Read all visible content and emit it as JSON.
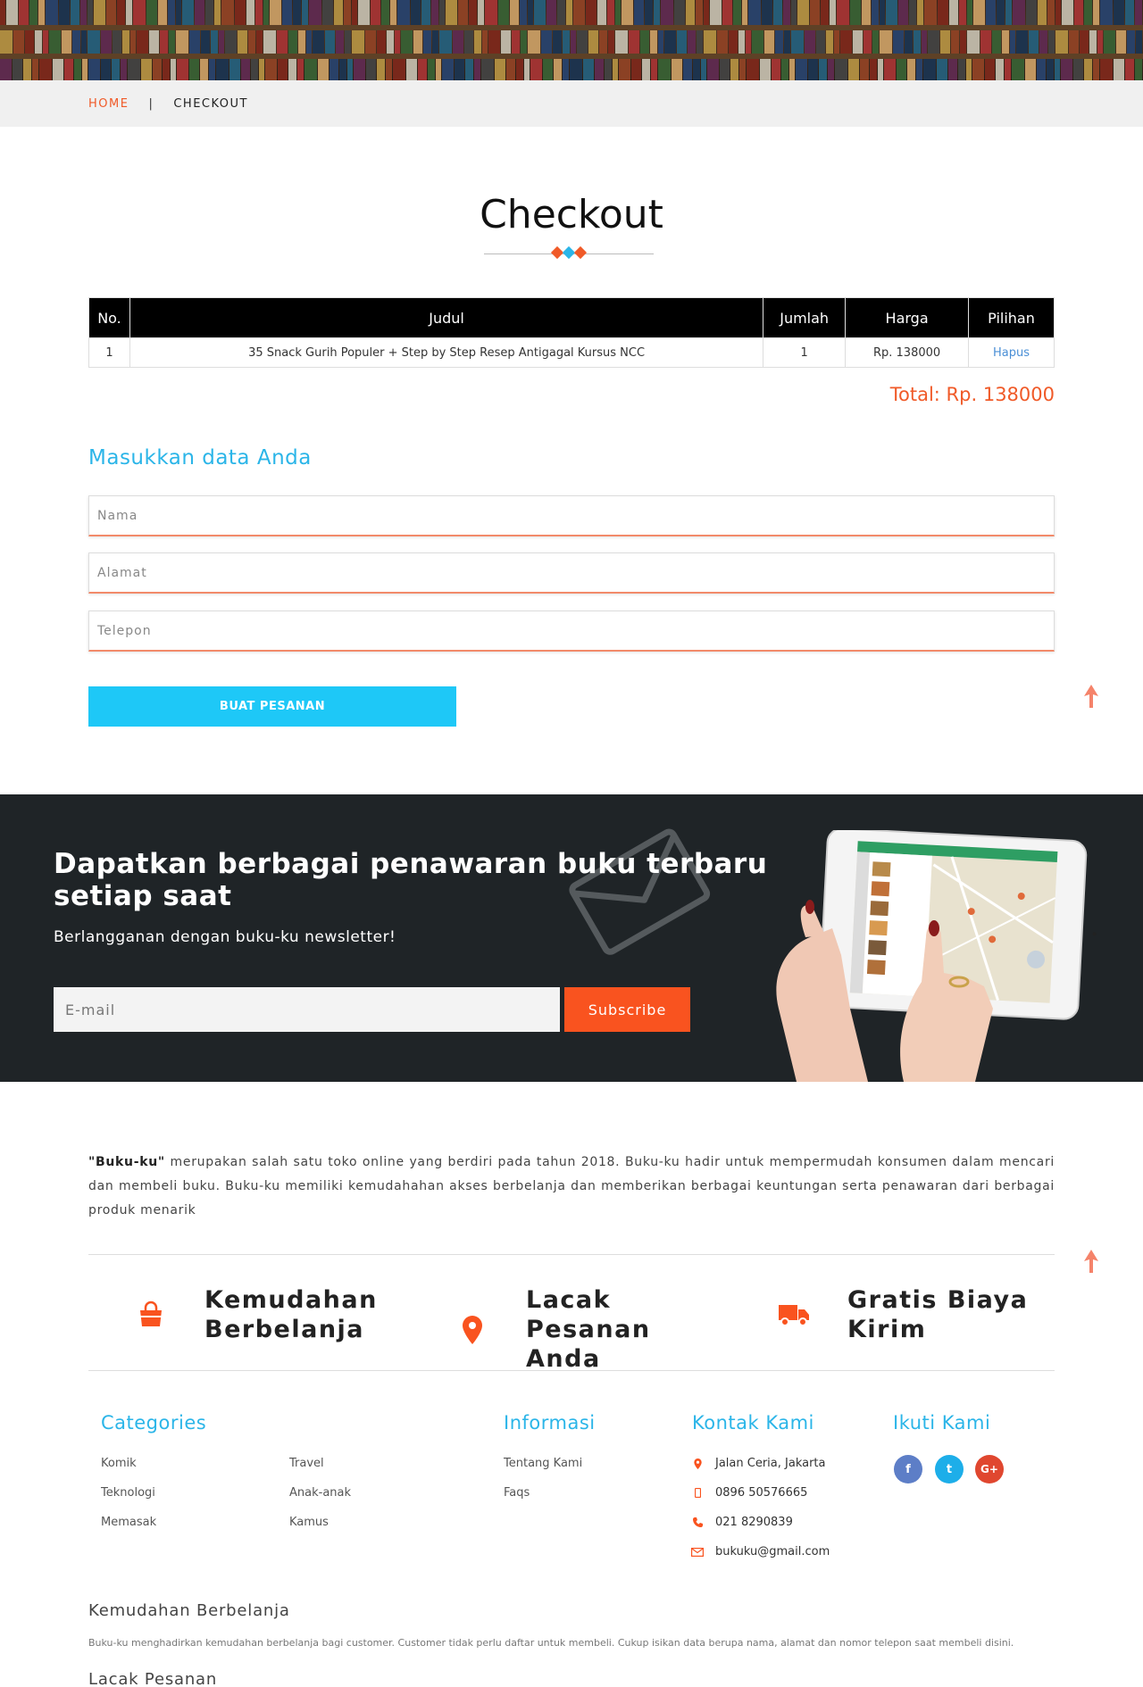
{
  "breadcrumb": {
    "home": "HOME",
    "separator": "|",
    "current": "CHECKOUT"
  },
  "page_title": "Checkout",
  "colors": {
    "accent_orange": "#f05a28",
    "accent_blue": "#2bb5e8",
    "button_blue": "#1ec8f7",
    "dark_bg": "#1f2427"
  },
  "cart": {
    "headers": [
      "No.",
      "Judul",
      "Jumlah",
      "Harga",
      "Pilihan"
    ],
    "rows": [
      {
        "no": "1",
        "title": "35 Snack Gurih Populer + Step by Step Resep Antigagal Kursus NCC",
        "qty": "1",
        "price": "Rp. 138000",
        "action": "Hapus"
      }
    ],
    "total": "Total: Rp. 138000"
  },
  "form": {
    "title": "Masukkan data Anda",
    "name_placeholder": "Nama",
    "address_placeholder": "Alamat",
    "phone_placeholder": "Telepon",
    "submit_label": "BUAT PESANAN"
  },
  "newsletter": {
    "title": "Dapatkan berbagai penawaran buku terbaru setiap saat",
    "subtitle": "Berlangganan dengan buku-ku newsletter!",
    "email_placeholder": "E-mail",
    "button_label": "Subscribe"
  },
  "about": {
    "brand": "\"Buku-ku\"",
    "text": " merupakan salah satu toko online yang berdiri pada tahun 2018. Buku-ku hadir untuk mempermudah konsumen dalam mencari dan membeli buku. Buku-ku memiliki kemudahahan akses berbelanja dan memberikan berbagai keuntungan serta penawaran dari berbagai produk menarik"
  },
  "features": [
    {
      "label": "Kemudahan Berbelanja",
      "icon": "shopping-bag-icon"
    },
    {
      "label": "Lacak Pesanan Anda",
      "icon": "map-marker-icon"
    },
    {
      "label": "Gratis Biaya Kirim",
      "icon": "truck-icon"
    }
  ],
  "footer": {
    "categories_title": "Categories",
    "categories_col1": [
      "Komik",
      "Teknologi",
      "Memasak"
    ],
    "categories_col2": [
      "Travel",
      "Anak-anak",
      "Kamus"
    ],
    "info_title": "Informasi",
    "info_links": [
      "Tentang Kami",
      "Faqs"
    ],
    "contact_title": "Kontak Kami",
    "contact": {
      "address": "Jalan Ceria, Jakarta",
      "mobile": "0896 50576665",
      "phone": "021 8290839",
      "email": "bukuku@gmail.com"
    },
    "follow_title": "Ikuti Kami",
    "social": [
      {
        "icon": "facebook-icon",
        "glyph": "f",
        "color": "#5d7ec7"
      },
      {
        "icon": "twitter-icon",
        "glyph": "t",
        "color": "#1daee9"
      },
      {
        "icon": "google-plus-icon",
        "glyph": "G+",
        "color": "#e0472f"
      }
    ]
  },
  "info_sections": [
    {
      "title": "Kemudahan Berbelanja",
      "text": "Buku-ku menghadirkan kemudahan berbelanja bagi customer. Customer tidak perlu daftar untuk membeli. Cukup isikan data berupa nama, alamat dan nomor telepon saat membeli disini."
    },
    {
      "title": "Lacak Pesanan"
    }
  ]
}
